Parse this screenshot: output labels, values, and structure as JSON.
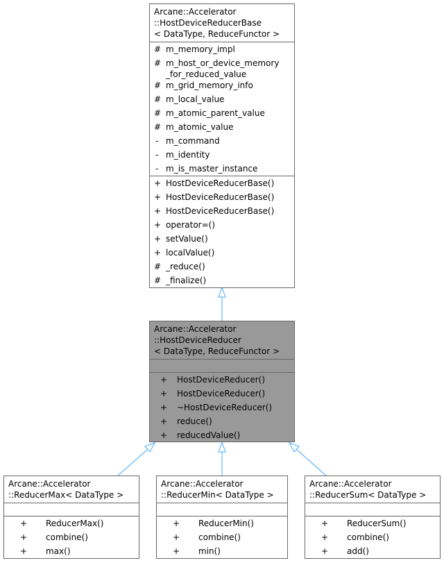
{
  "diagram": {
    "type": "uml-class-inheritance",
    "edge_color": "#63b8ff",
    "highlight_color": "#999999",
    "base": {
      "title_lines": [
        "Arcane::Accelerator",
        "::HostDeviceReducerBase",
        "< DataType, ReduceFunctor >"
      ],
      "attributes": [
        {
          "vis": "#",
          "name": "m_memory_impl"
        },
        {
          "vis": "#",
          "name": "m_host_or_device_memory",
          "name2": "_for_reduced_value"
        },
        {
          "vis": "#",
          "name": "m_grid_memory_info"
        },
        {
          "vis": "#",
          "name": "m_local_value"
        },
        {
          "vis": "#",
          "name": "m_atomic_parent_value"
        },
        {
          "vis": "#",
          "name": "m_atomic_value"
        },
        {
          "vis": "-",
          "name": "m_command"
        },
        {
          "vis": "-",
          "name": "m_identity"
        },
        {
          "vis": "-",
          "name": "m_is_master_instance"
        }
      ],
      "methods": [
        {
          "vis": "+",
          "name": "HostDeviceReducerBase()"
        },
        {
          "vis": "+",
          "name": "HostDeviceReducerBase()"
        },
        {
          "vis": "+",
          "name": "HostDeviceReducerBase()"
        },
        {
          "vis": "+",
          "name": "operator=()"
        },
        {
          "vis": "+",
          "name": "setValue()"
        },
        {
          "vis": "+",
          "name": "localValue()"
        },
        {
          "vis": "#",
          "name": "_reduce()"
        },
        {
          "vis": "#",
          "name": "_finalize()"
        }
      ]
    },
    "current": {
      "title_lines": [
        "Arcane::Accelerator",
        "::HostDeviceReducer",
        "< DataType, ReduceFunctor >"
      ],
      "methods": [
        {
          "vis": "+",
          "name": "HostDeviceReducer()"
        },
        {
          "vis": "+",
          "name": "HostDeviceReducer()"
        },
        {
          "vis": "+",
          "name": "~HostDeviceReducer()"
        },
        {
          "vis": "+",
          "name": "reduce()"
        },
        {
          "vis": "+",
          "name": "reducedValue()"
        }
      ]
    },
    "derived": [
      {
        "title_lines": [
          "Arcane::Accelerator",
          "::ReducerMax< DataType >"
        ],
        "methods": [
          {
            "vis": "+",
            "name": "ReducerMax()"
          },
          {
            "vis": "+",
            "name": "combine()"
          },
          {
            "vis": "+",
            "name": "max()"
          }
        ]
      },
      {
        "title_lines": [
          "Arcane::Accelerator",
          "::ReducerMin< DataType >"
        ],
        "methods": [
          {
            "vis": "+",
            "name": "ReducerMin()"
          },
          {
            "vis": "+",
            "name": "combine()"
          },
          {
            "vis": "+",
            "name": "min()"
          }
        ]
      },
      {
        "title_lines": [
          "Arcane::Accelerator",
          "::ReducerSum< DataType >"
        ],
        "methods": [
          {
            "vis": "+",
            "name": "ReducerSum()"
          },
          {
            "vis": "+",
            "name": "combine()"
          },
          {
            "vis": "+",
            "name": "add()"
          }
        ]
      }
    ]
  }
}
